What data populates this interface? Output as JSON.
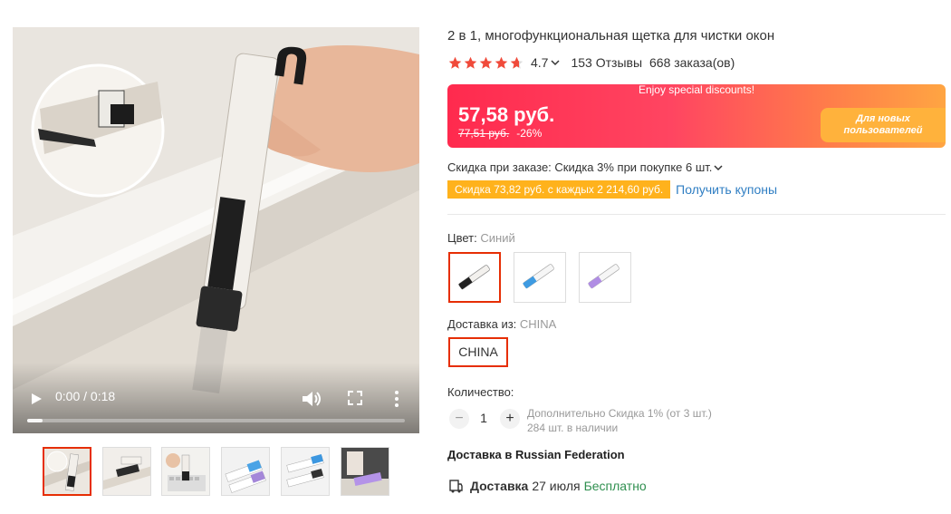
{
  "video": {
    "time": "0:00 / 0:18",
    "progress": 0.04
  },
  "thumbnails": [
    {
      "name": "thumb-1",
      "active": true
    },
    {
      "name": "thumb-2",
      "active": false
    },
    {
      "name": "thumb-3",
      "active": false
    },
    {
      "name": "thumb-4",
      "active": false
    },
    {
      "name": "thumb-5",
      "active": false
    },
    {
      "name": "thumb-6",
      "active": false
    }
  ],
  "product": {
    "title": "2 в 1, многофункциональная щетка для чистки окон",
    "rating": "4.7",
    "stars": 4.7,
    "reviews": "153 Отзывы",
    "orders": "668 заказа(ов)"
  },
  "price": {
    "banner": "Enjoy special discounts!",
    "current": "57,58 руб.",
    "old": "77,51 руб.",
    "discount": "-26%",
    "new_user_badge": "Для новых пользователей"
  },
  "discounts": {
    "order_discount": "Скидка при заказе: Скидка 3% при покупке 6 шт.",
    "coupon_tag": "Скидка 73,82 руб. с каждых 2 214,60 руб.",
    "coupon_link": "Получить купоны"
  },
  "options": {
    "color_label": "Цвет:",
    "color_value": "Синий",
    "swatches": [
      "black",
      "blue",
      "purple"
    ],
    "ship_from_label": "Доставка из:",
    "ship_from_value": "CHINA",
    "ship_option": "CHINA"
  },
  "quantity": {
    "label": "Количество:",
    "minus": "−",
    "plus": "+",
    "value": "1",
    "extra_discount": "Дополнительно Скидка 1% (от 3 шт.)",
    "stock": "284 шт. в наличии"
  },
  "delivery": {
    "heading": "Доставка в Russian Federation",
    "label": "Доставка",
    "date": "27 июля",
    "cost": "Бесплатно"
  },
  "colors": {
    "accent_red": "#e62e04",
    "star": "#f04a3a",
    "link": "#2f7ec3",
    "coupon": "#ffb21c",
    "free": "#2f8f4f"
  }
}
